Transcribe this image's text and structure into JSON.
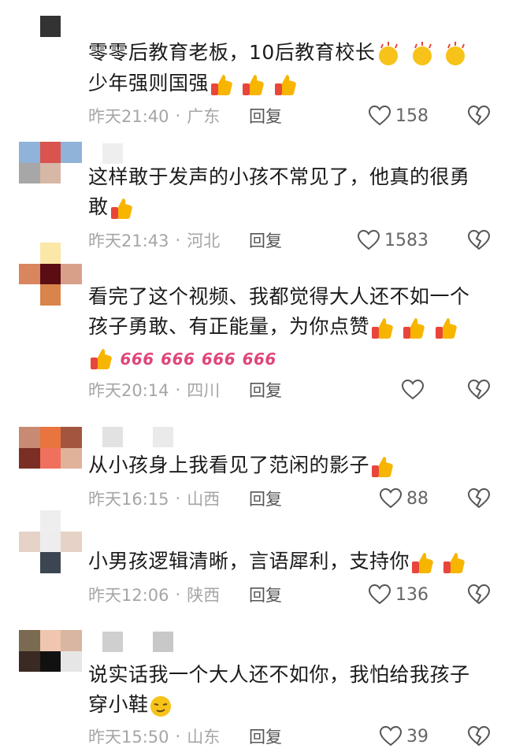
{
  "comments": [
    {
      "lines": [
        "零零后教育老板，10后教育校长",
        "少年强则国强"
      ],
      "time": "昨天21:40",
      "dot": "·",
      "location": "广东",
      "reply": "回复",
      "likes": "158"
    },
    {
      "lines": [
        "这样敢于发声的小孩不常见了，他真的很勇",
        "敢"
      ],
      "time": "昨天21:43",
      "dot": "·",
      "location": "河北",
      "reply": "回复",
      "likes": "1583"
    },
    {
      "lines": [
        "看完了这个视频、我都觉得大人还不如一个",
        "孩子勇敢、有正能量，为你点赞"
      ],
      "time": "昨天20:14",
      "dot": "·",
      "location": "四川",
      "reply": "回复",
      "likes": ""
    },
    {
      "lines": [
        "从小孩身上我看见了范闲的影子"
      ],
      "time": "昨天16:15",
      "dot": "·",
      "location": "山西",
      "reply": "回复",
      "likes": "88"
    },
    {
      "lines": [
        "小男孩逻辑清晰，言语犀利，支持你"
      ],
      "time": "昨天12:06",
      "dot": "·",
      "location": "陕西",
      "reply": "回复",
      "likes": "136"
    },
    {
      "lines": [
        "说实话我一个大人还不如你，我怕给我孩子",
        "穿小鞋"
      ],
      "time": "昨天15:50",
      "dot": "·",
      "location": "山东",
      "reply": "回复",
      "likes": "39"
    }
  ],
  "six_text": "666",
  "colors": {
    "meta": "#a6a6a6",
    "thumb_yellow": "#f7b500",
    "thumb_red": "#e8463a",
    "six_pink": "#e0457b"
  }
}
